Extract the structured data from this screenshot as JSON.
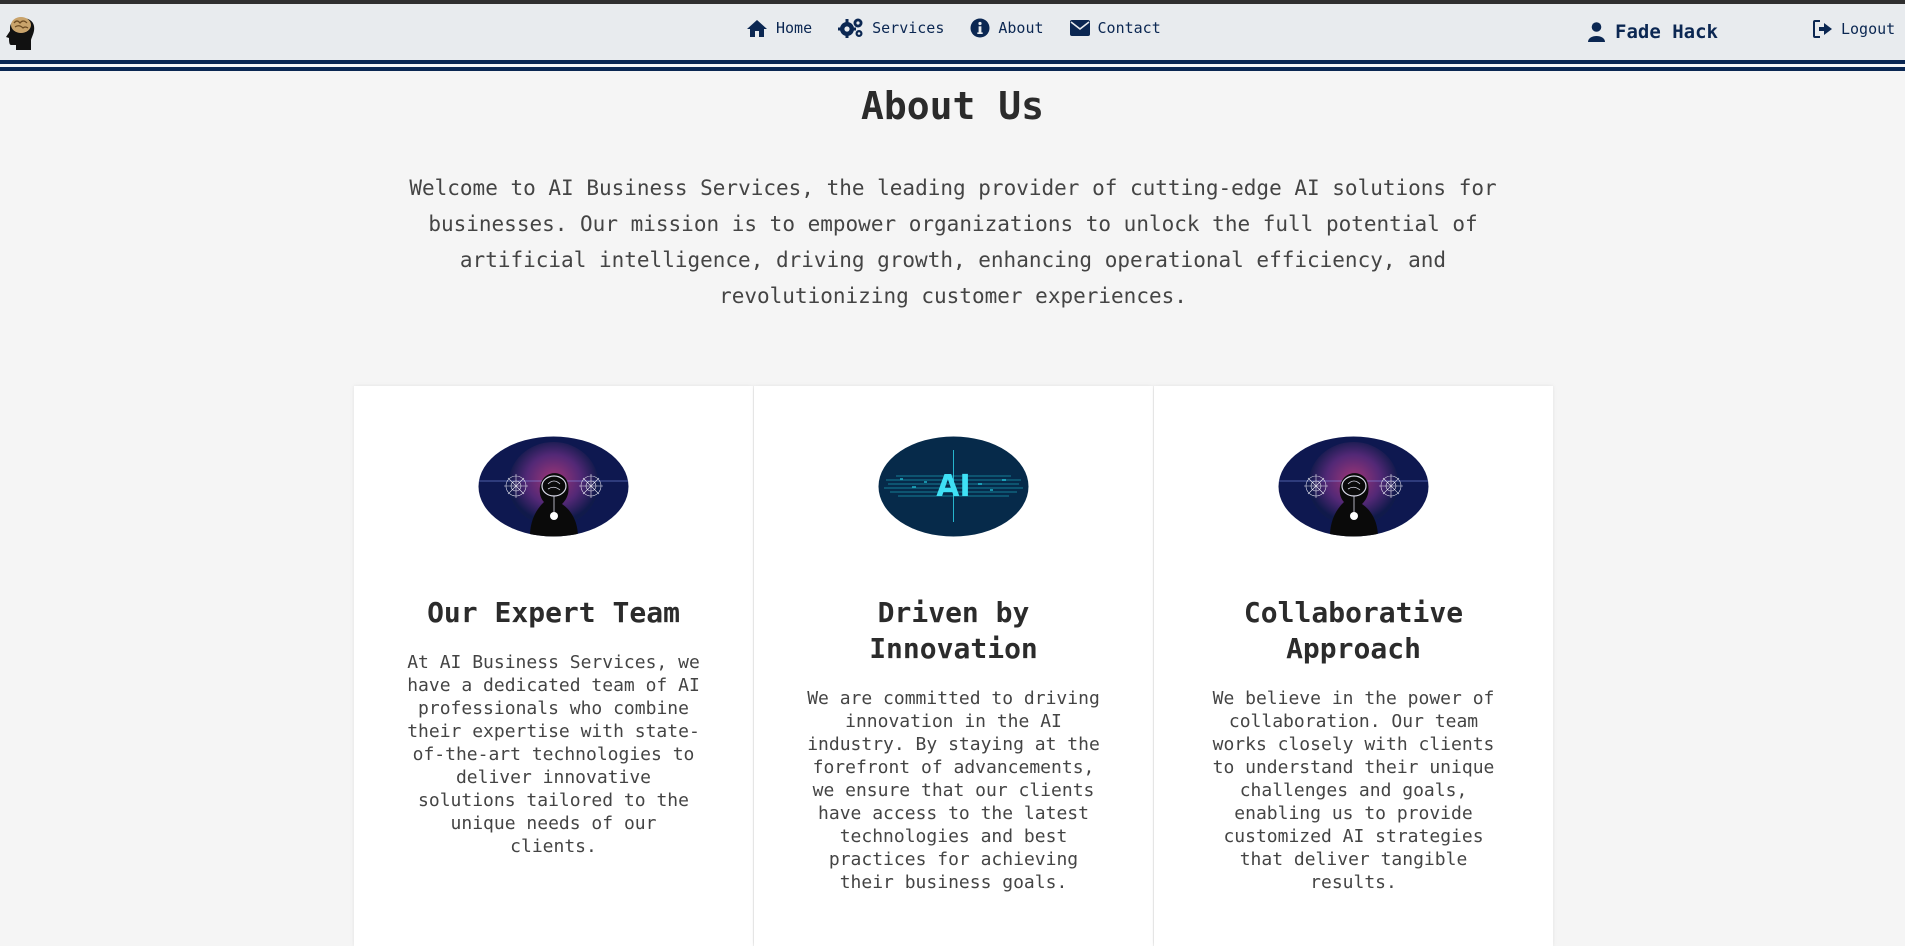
{
  "nav": {
    "items": [
      {
        "label": "Home",
        "icon": "home-icon"
      },
      {
        "label": "Services",
        "icon": "cogs-icon"
      },
      {
        "label": "About",
        "icon": "info-icon"
      },
      {
        "label": "Contact",
        "icon": "envelope-icon"
      }
    ],
    "user_name": "Fade Hack",
    "logout_label": "Logout"
  },
  "page": {
    "title": "About Us",
    "intro": "Welcome to AI Business Services, the leading provider of cutting-edge AI solutions for businesses. Our mission is to empower organizations to unlock the full potential of artificial intelligence, driving growth, enhancing operational efficiency, and revolutionizing customer experiences."
  },
  "cards": [
    {
      "title": "Our Expert Team",
      "text": "At AI Business Services, we have a dedicated team of AI professionals who combine their expertise with state-of-the-art technologies to deliver innovative solutions tailored to the unique needs of our clients.",
      "image": "brain-network-image"
    },
    {
      "title": "Driven by Innovation",
      "text": "We are committed to driving innovation in the AI industry. By staying at the forefront of advancements, we ensure that our clients have access to the latest technologies and best practices for achieving their business goals.",
      "image": "ai-circuit-image",
      "image_text": "AI"
    },
    {
      "title": "Collaborative Approach",
      "text": "We believe in the power of collaboration. Our team works closely with clients to understand their unique challenges and goals, enabling us to provide customized AI strategies that deliver tangible results.",
      "image": "brain-network-image"
    }
  ],
  "colors": {
    "navy": "#0b2752",
    "background": "#f5f5f5",
    "navbar": "#e8ebee"
  }
}
